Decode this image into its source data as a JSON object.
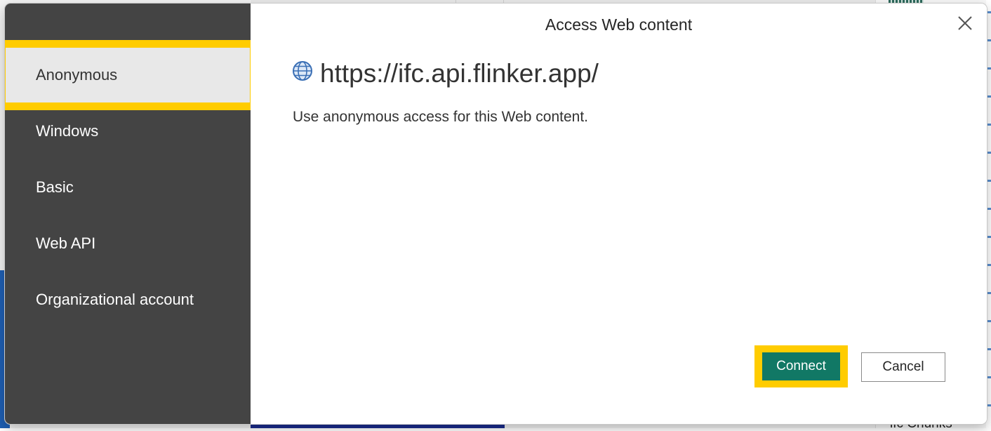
{
  "background": {
    "bottom_right_label": "ifc Chunks"
  },
  "dialog": {
    "title": "Access Web content",
    "close_icon": "close-icon",
    "auth_methods": [
      {
        "label": "Anonymous",
        "selected": true
      },
      {
        "label": "Windows",
        "selected": false
      },
      {
        "label": "Basic",
        "selected": false
      },
      {
        "label": "Web API",
        "selected": false
      },
      {
        "label": "Organizational account",
        "selected": false
      }
    ],
    "url_icon": "globe-icon",
    "url": "https://ifc.api.flinker.app/",
    "description": "Use anonymous access for this Web content.",
    "buttons": {
      "connect": "Connect",
      "cancel": "Cancel"
    }
  },
  "colors": {
    "nav_background": "#444444",
    "selected_item": "#e8e8e8",
    "highlight": "#ffcc00",
    "primary_button": "#117865"
  }
}
